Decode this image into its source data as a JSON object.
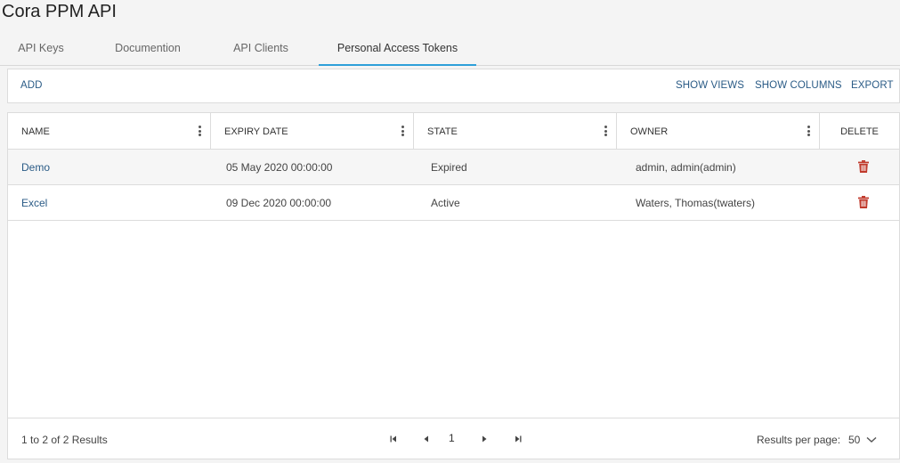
{
  "app": {
    "title": "Cora PPM API"
  },
  "tabs": [
    {
      "label": "API Keys"
    },
    {
      "label": "Documention"
    },
    {
      "label": "API Clients"
    },
    {
      "label": "Personal Access Tokens"
    }
  ],
  "active_tab": "Personal Access Tokens",
  "toolbar": {
    "add_label": "ADD",
    "show_views_label": "SHOW VIEWS",
    "show_columns_label": "SHOW COLUMNS",
    "export_label": "EXPORT"
  },
  "table": {
    "columns": [
      {
        "label": "NAME"
      },
      {
        "label": "EXPIRY DATE"
      },
      {
        "label": "STATE"
      },
      {
        "label": "OWNER"
      },
      {
        "label": "DELETE"
      }
    ],
    "rows": [
      {
        "name": "Demo",
        "expiry": "05 May 2020 00:00:00",
        "state": "Expired",
        "owner": "admin, admin(admin)"
      },
      {
        "name": "Excel",
        "expiry": "09 Dec 2020 00:00:00",
        "state": "Active",
        "owner": "Waters, Thomas(twaters)"
      }
    ]
  },
  "footer": {
    "results_text": "1 to 2 of 2 Results",
    "current_page": "1",
    "results_per_page_label": "Results per page:",
    "results_per_page_value": "50"
  },
  "colors": {
    "accent": "#2d9fd9",
    "link": "#2a5b86",
    "delete": "#c0392b"
  },
  "icons": {
    "kebab": "vertical-dots-icon",
    "delete": "trash-icon",
    "first": "first-page-icon",
    "prev": "prev-page-icon",
    "next": "next-page-icon",
    "last": "last-page-icon",
    "dropdown": "chevron-down-icon"
  }
}
